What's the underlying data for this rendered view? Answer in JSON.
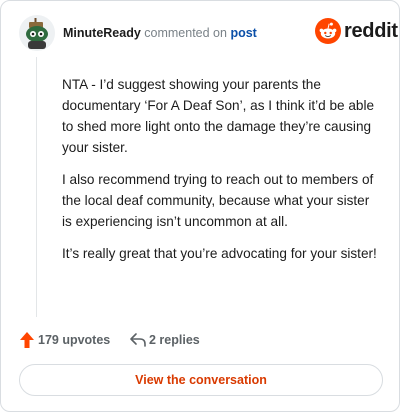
{
  "comment": {
    "username": "MinuteReady",
    "action_text": "commented on",
    "post_link": "post",
    "paragraphs": [
      "NTA - I’d suggest showing your parents the documentary ‘For A Deaf Son’, as I think it’d be able to shed more light onto the damage they’re causing your sister.",
      "I also recommend trying to reach out to members of the local deaf community, because what your sister is experiencing isn’t uncommon at all.",
      "It’s really great that you’re advocating for your sister!"
    ],
    "upvotes": "179 upvotes",
    "replies": "2 replies"
  },
  "brand": {
    "wordmark": "reddit",
    "color": "#ff4500"
  },
  "button": {
    "view_conversation": "View the conversation"
  },
  "icons": {
    "upvote": "upvote-arrow-icon",
    "reply": "reply-arrow-icon",
    "logo": "reddit-snoo-icon"
  }
}
